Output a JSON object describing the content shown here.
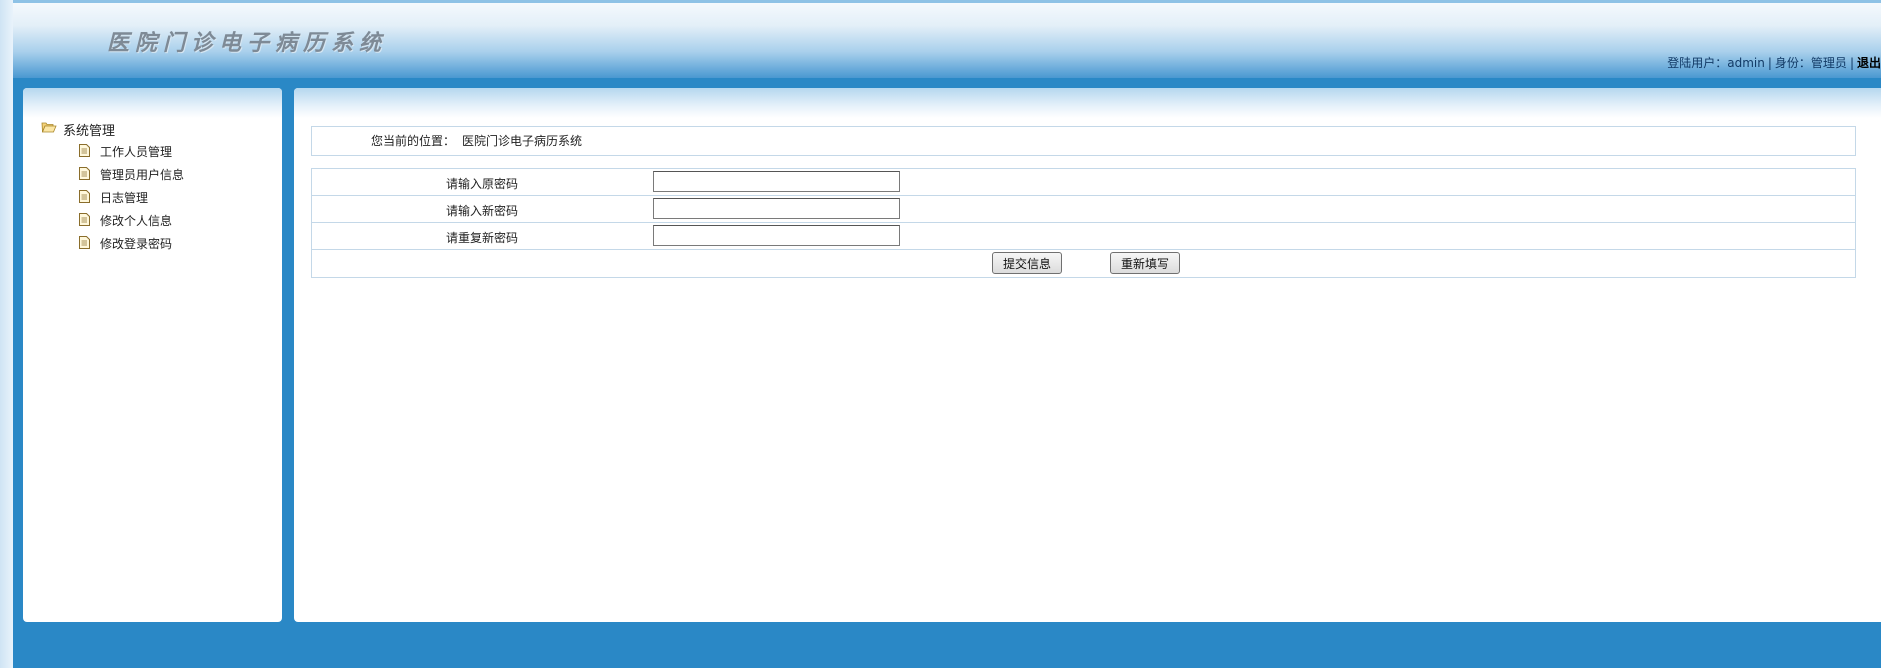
{
  "app": {
    "title": "医院门诊电子病历系统"
  },
  "header": {
    "user_label": "登陆用户：",
    "user_name": "admin",
    "separator": "|",
    "role_label": "身份：",
    "role_name": "管理员",
    "logout": "退出"
  },
  "sidebar": {
    "root": "系统管理",
    "items": [
      {
        "label": "工作人员管理"
      },
      {
        "label": "管理员用户信息"
      },
      {
        "label": "日志管理"
      },
      {
        "label": "修改个人信息"
      },
      {
        "label": "修改登录密码"
      }
    ]
  },
  "breadcrumb": {
    "label": "您当前的位置：",
    "path": "医院门诊电子病历系统"
  },
  "form": {
    "old_password_label": "请输入原密码",
    "old_password_value": "",
    "new_password_label": "请输入新密码",
    "new_password_value": "",
    "confirm_password_label": "请重复新密码",
    "confirm_password_value": "",
    "submit_label": "提交信息",
    "reset_label": "重新填写"
  },
  "colors": {
    "main_blue": "#2a88c6",
    "header_gradient_top": "#f4f9fd",
    "header_gradient_bottom": "#4a98d1",
    "border": "#c4d8e8"
  }
}
